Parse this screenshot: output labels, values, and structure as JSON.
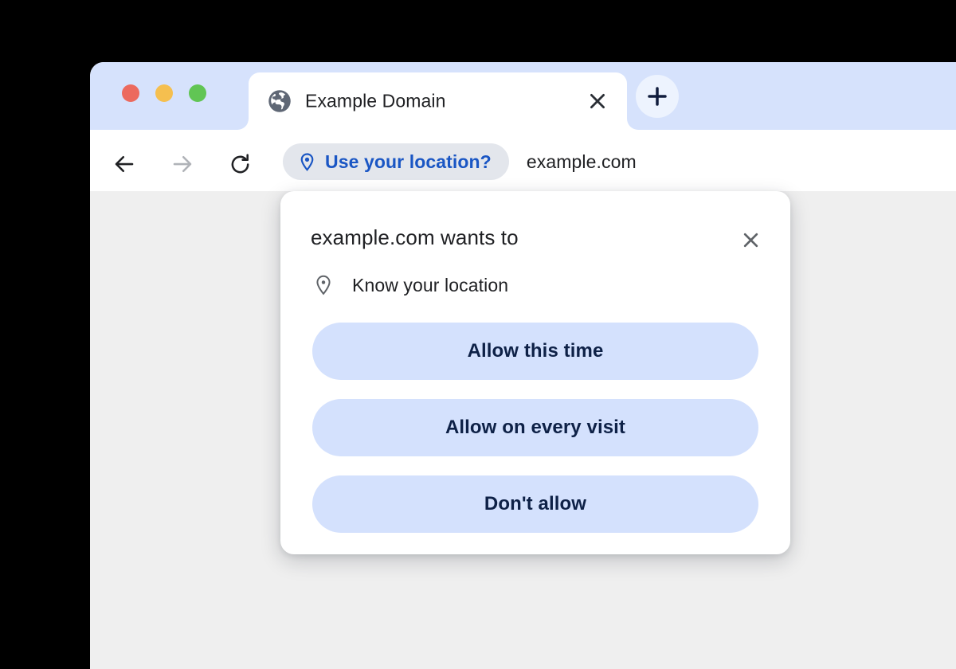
{
  "window": {
    "traffic_lights": [
      {
        "name": "close",
        "color": "#ec6a5e"
      },
      {
        "name": "minimize",
        "color": "#f5bf4f"
      },
      {
        "name": "maximize",
        "color": "#61c554"
      }
    ],
    "tab_strip_color": "#d6e2fc",
    "content_background": "#efefef"
  },
  "tab": {
    "favicon": "globe-icon",
    "title": "Example Domain",
    "close_icon": "close-icon"
  },
  "new_tab": {
    "icon": "plus-icon",
    "label": "+"
  },
  "toolbar": {
    "back_icon": "arrow-left-icon",
    "forward_icon": "arrow-right-icon",
    "reload_icon": "reload-icon",
    "location_chip": {
      "icon": "location-pin-icon",
      "label": "Use your location?",
      "text_color": "#1a56c4",
      "background": "#e3e6ec"
    },
    "url": "example.com"
  },
  "dialog": {
    "title": "example.com wants to",
    "close_icon": "close-icon",
    "permission": {
      "icon": "location-pin-icon",
      "label": "Know your location"
    },
    "actions": [
      {
        "name": "allow-once",
        "label": "Allow this time"
      },
      {
        "name": "allow-every",
        "label": "Allow on every visit"
      },
      {
        "name": "deny",
        "label": "Don't allow"
      }
    ],
    "button_background": "#d4e1fd",
    "button_text_color": "#0e2147"
  }
}
